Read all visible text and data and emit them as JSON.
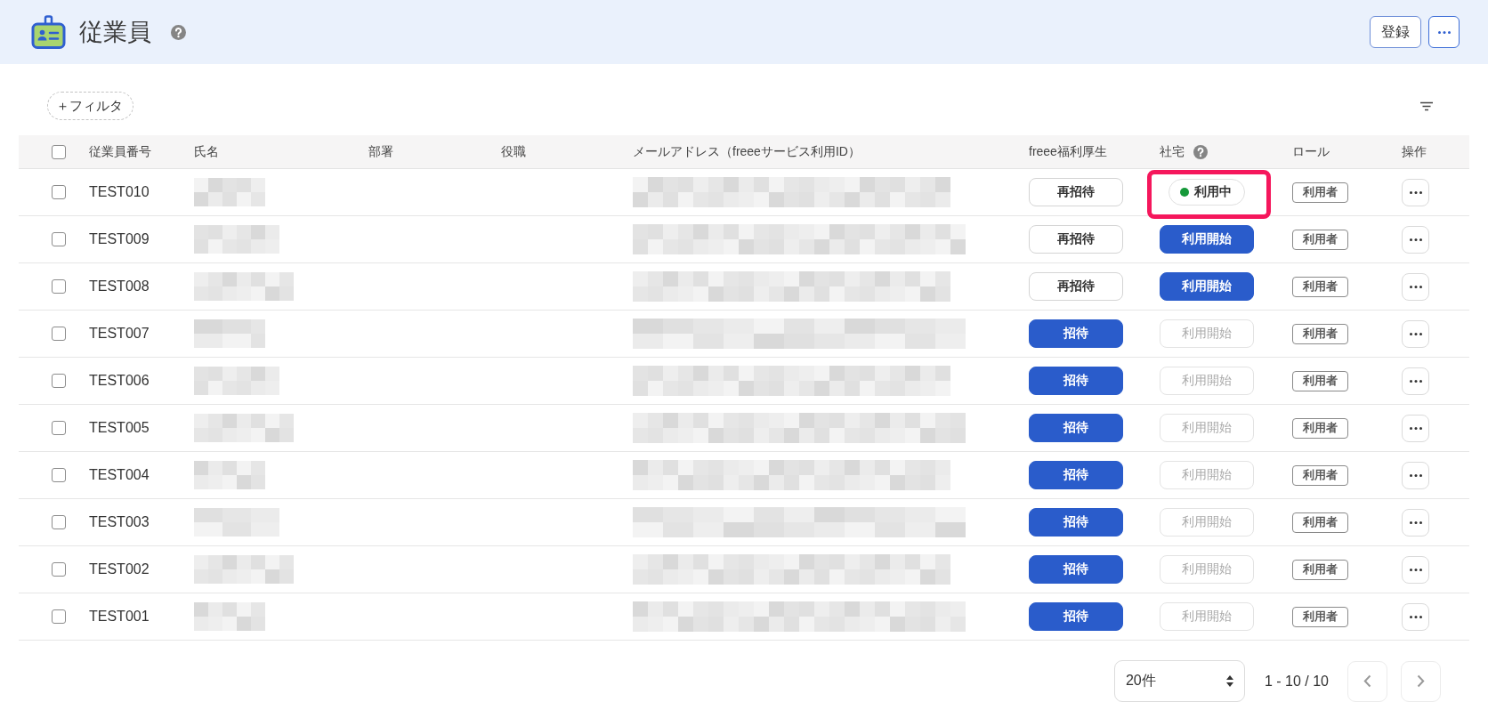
{
  "page_header": {
    "title": "従業員",
    "buttons": [
      {
        "label": "登録"
      }
    ]
  },
  "filter_button": {
    "label": "＋フィルタ"
  },
  "table": {
    "select_all": {
      "checked": false
    },
    "columns": [
      {
        "label": "従業員番号",
        "help": false
      },
      {
        "label": "氏名",
        "help": false
      },
      {
        "label": "部署",
        "help": false
      },
      {
        "label": "役職",
        "help": false
      },
      {
        "label": "メールアドレス（freeeサービス利用ID）",
        "help": false
      },
      {
        "label": "freee福利厚生",
        "help": false
      },
      {
        "label": "社宅",
        "help": true
      },
      {
        "label": "ロール",
        "help": false
      },
      {
        "label": "操作",
        "help": false
      }
    ],
    "rows": [
      {
        "checked": false,
        "employee_id": "TEST010",
        "name_redacted": true,
        "email_redacted": true,
        "benefits": {
          "label": "再招待",
          "kind": "secondary"
        },
        "housing": {
          "label": "利用中",
          "kind": "status",
          "highlighted": true
        },
        "role": "利用者"
      },
      {
        "checked": false,
        "employee_id": "TEST009",
        "name_redacted": true,
        "email_redacted": true,
        "benefits": {
          "label": "再招待",
          "kind": "secondary"
        },
        "housing": {
          "label": "利用開始",
          "kind": "button",
          "disabled": false,
          "highlighted": false
        },
        "role": "利用者"
      },
      {
        "checked": false,
        "employee_id": "TEST008",
        "name_redacted": true,
        "email_redacted": true,
        "benefits": {
          "label": "再招待",
          "kind": "secondary"
        },
        "housing": {
          "label": "利用開始",
          "kind": "button",
          "disabled": false,
          "highlighted": false
        },
        "role": "利用者"
      },
      {
        "checked": false,
        "employee_id": "TEST007",
        "name_redacted": true,
        "email_redacted": true,
        "benefits": {
          "label": "招待",
          "kind": "primary"
        },
        "housing": {
          "label": "利用開始",
          "kind": "button",
          "disabled": true,
          "highlighted": false
        },
        "role": "利用者"
      },
      {
        "checked": false,
        "employee_id": "TEST006",
        "name_redacted": true,
        "email_redacted": true,
        "benefits": {
          "label": "招待",
          "kind": "primary"
        },
        "housing": {
          "label": "利用開始",
          "kind": "button",
          "disabled": true,
          "highlighted": false
        },
        "role": "利用者"
      },
      {
        "checked": false,
        "employee_id": "TEST005",
        "name_redacted": true,
        "email_redacted": true,
        "benefits": {
          "label": "招待",
          "kind": "primary"
        },
        "housing": {
          "label": "利用開始",
          "kind": "button",
          "disabled": true,
          "highlighted": false
        },
        "role": "利用者"
      },
      {
        "checked": false,
        "employee_id": "TEST004",
        "name_redacted": true,
        "email_redacted": true,
        "benefits": {
          "label": "招待",
          "kind": "primary"
        },
        "housing": {
          "label": "利用開始",
          "kind": "button",
          "disabled": true,
          "highlighted": false
        },
        "role": "利用者"
      },
      {
        "checked": false,
        "employee_id": "TEST003",
        "name_redacted": true,
        "email_redacted": true,
        "benefits": {
          "label": "招待",
          "kind": "primary"
        },
        "housing": {
          "label": "利用開始",
          "kind": "button",
          "disabled": true,
          "highlighted": false
        },
        "role": "利用者"
      },
      {
        "checked": false,
        "employee_id": "TEST002",
        "name_redacted": true,
        "email_redacted": true,
        "benefits": {
          "label": "招待",
          "kind": "primary"
        },
        "housing": {
          "label": "利用開始",
          "kind": "button",
          "disabled": true,
          "highlighted": false
        },
        "role": "利用者"
      },
      {
        "checked": false,
        "employee_id": "TEST001",
        "name_redacted": true,
        "email_redacted": true,
        "benefits": {
          "label": "招待",
          "kind": "primary"
        },
        "housing": {
          "label": "利用開始",
          "kind": "button",
          "disabled": true,
          "highlighted": false
        },
        "role": "利用者"
      }
    ]
  },
  "pagination": {
    "page_size": "20件",
    "range": "1 - 10 / 10"
  }
}
